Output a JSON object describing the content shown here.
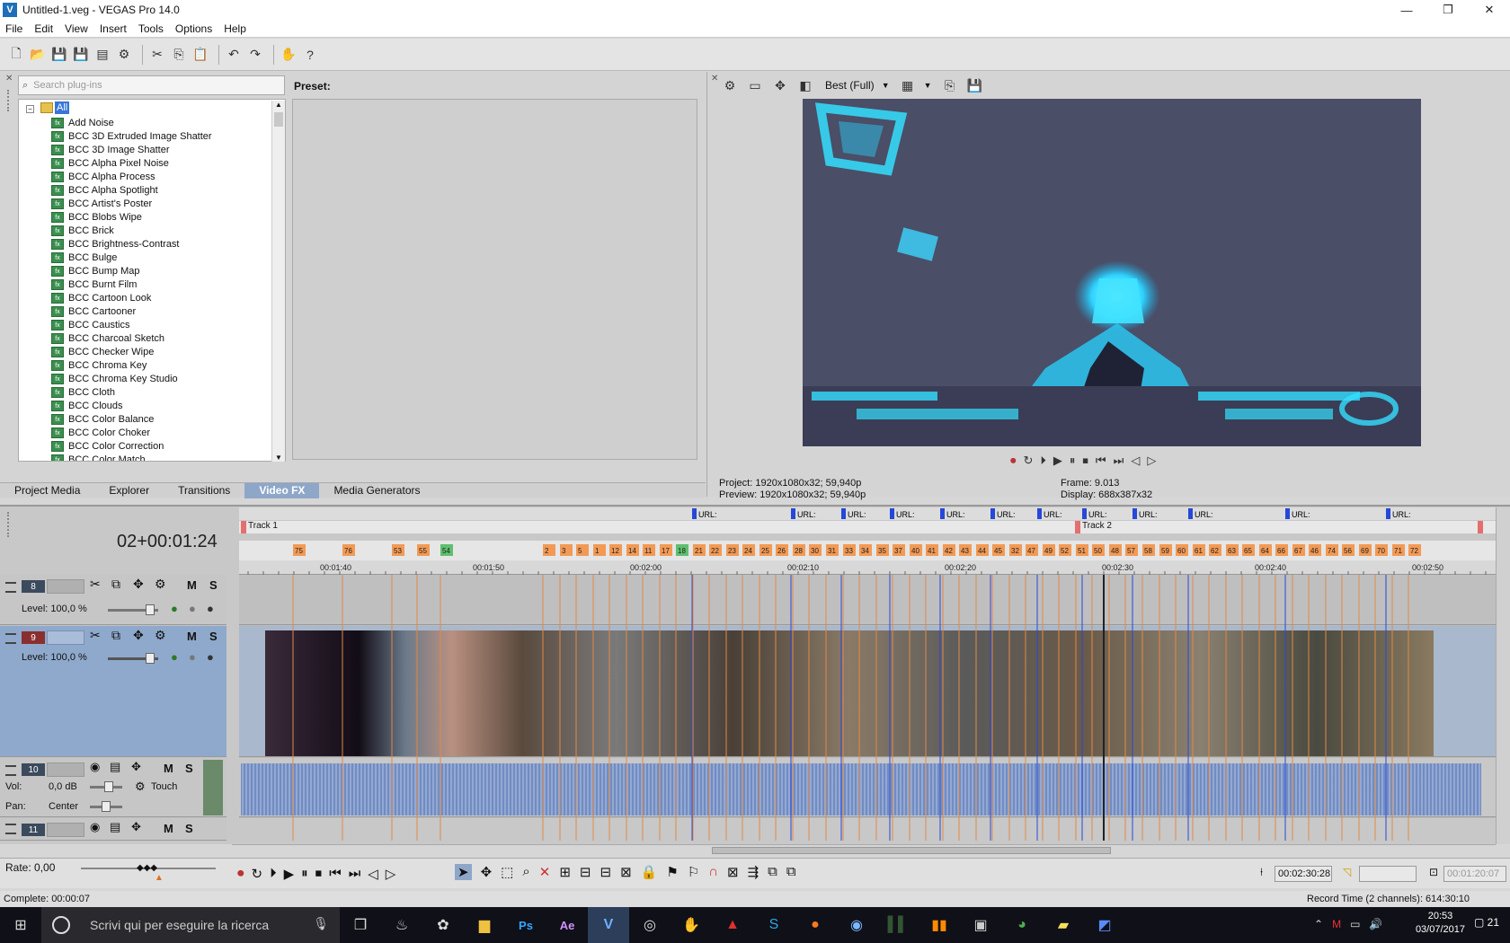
{
  "window": {
    "title": "Untitled-1.veg - VEGAS Pro 14.0",
    "min": "—",
    "max": "❐",
    "close": "✕"
  },
  "menu": [
    "File",
    "Edit",
    "View",
    "Insert",
    "Tools",
    "Options",
    "Help"
  ],
  "plugins": {
    "search_placeholder": "Search plug-ins",
    "root": "All",
    "items": [
      "Add Noise",
      "BCC 3D Extruded Image Shatter",
      "BCC 3D Image Shatter",
      "BCC Alpha Pixel Noise",
      "BCC Alpha Process",
      "BCC Alpha Spotlight",
      "BCC Artist's Poster",
      "BCC Blobs Wipe",
      "BCC Brick",
      "BCC Brightness-Contrast",
      "BCC Bulge",
      "BCC Bump Map",
      "BCC Burnt Film",
      "BCC Cartoon Look",
      "BCC Cartooner",
      "BCC Caustics",
      "BCC Charcoal Sketch",
      "BCC Checker Wipe",
      "BCC Chroma Key",
      "BCC Chroma Key Studio",
      "BCC Cloth",
      "BCC Clouds",
      "BCC Color Balance",
      "BCC Color Choker",
      "BCC Color Correction",
      "BCC Color Match"
    ],
    "preset_label": "Preset:"
  },
  "tabs": [
    {
      "label": "Project Media",
      "active": false
    },
    {
      "label": "Explorer",
      "active": false
    },
    {
      "label": "Transitions",
      "active": false
    },
    {
      "label": "Video FX",
      "active": true
    },
    {
      "label": "Media Generators",
      "active": false
    }
  ],
  "preview": {
    "quality": "Best (Full)",
    "project": "Project:   1920x1080x32; 59,940p",
    "preview": "Preview:  1920x1080x32; 59,940p",
    "frame": "Frame:     9.013",
    "display": "Display:   688x387x32"
  },
  "timeline": {
    "timecode": "02+00:01:24",
    "region1": "Track 1",
    "region2": "Track 2",
    "ruler": [
      "00:01:40",
      "00:01:50",
      "00:02:00",
      "00:02:10",
      "00:02:20",
      "00:02:30",
      "00:02:40",
      "00:02:50"
    ],
    "url_label": "URL:",
    "tracks": [
      {
        "num": "8",
        "level": "Level: 100,0 %"
      },
      {
        "num": "9",
        "level": "Level: 100,0 %"
      },
      {
        "num": "10",
        "vol": "Vol:",
        "vol_value": "0,0 dB",
        "pan": "Pan:",
        "pan_value": "Center",
        "mode": "Touch"
      },
      {
        "num": "11"
      }
    ],
    "mute": "M",
    "solo": "S",
    "marker_nums": [
      "75",
      "76",
      "53",
      "55",
      "54",
      "2",
      "3",
      "5",
      "1",
      "12",
      "14",
      "11",
      "17",
      "18",
      "21",
      "22",
      "23",
      "24",
      "25",
      "26",
      "28",
      "30",
      "31",
      "33",
      "34",
      "35",
      "37",
      "40",
      "41",
      "42",
      "43",
      "44",
      "45",
      "32",
      "47",
      "49",
      "52",
      "51",
      "50",
      "48",
      "57",
      "58",
      "59",
      "60",
      "61",
      "62",
      "63",
      "65",
      "64",
      "66",
      "67",
      "46",
      "74",
      "56",
      "69",
      "70",
      "71",
      "72"
    ]
  },
  "bottom": {
    "rate": "Rate: 0,00",
    "cursor_time": "00:02:30:28",
    "end_time": "00:01:20:07",
    "status": "Complete: 00:00:07",
    "record": "Record Time (2 channels): 614:30:10"
  },
  "taskbar": {
    "search": "Scrivi qui per eseguire la ricerca",
    "time": "20:53",
    "date": "03/07/2017",
    "notif": "21"
  }
}
